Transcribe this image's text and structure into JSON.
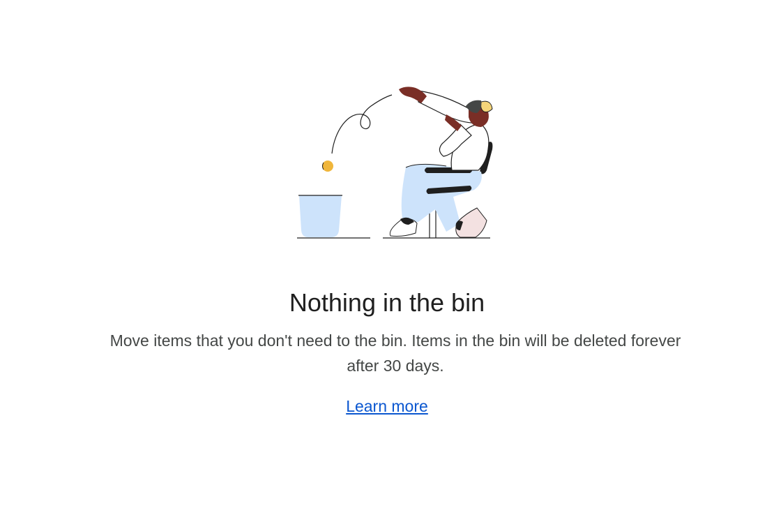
{
  "empty_state": {
    "title": "Nothing in the bin",
    "description": "Move items that you don't need to the bin. Items in the bin will be deleted forever after 30 days.",
    "learn_more_label": "Learn more",
    "illustration_icon": "person-tossing-item-into-bin-illustration"
  },
  "colors": {
    "title": "#1f1f1f",
    "description": "#444746",
    "link": "#0b57d0",
    "bin_fill": "#cde3fb",
    "coin": "#f0b63b"
  }
}
